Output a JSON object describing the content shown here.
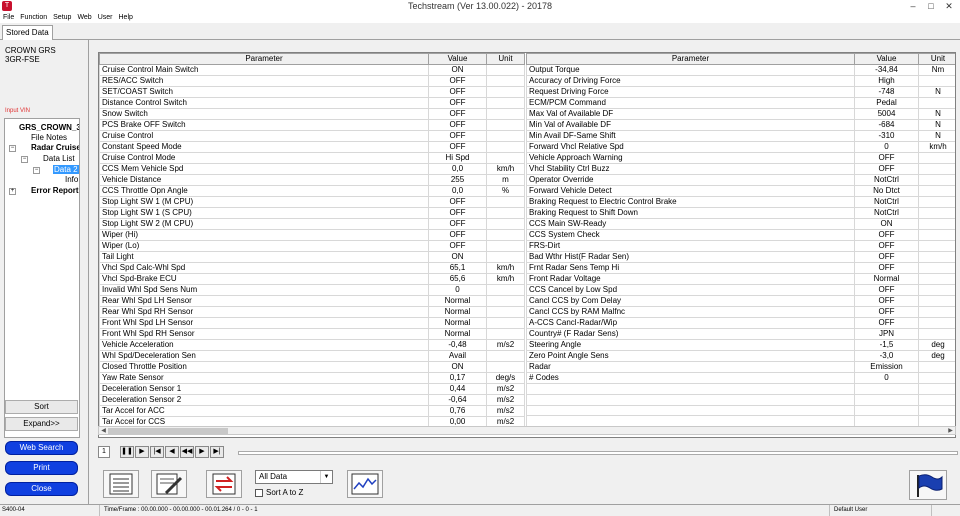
{
  "window": {
    "title": "Techstream (Ver 13.00.022) - 20178",
    "minimize": "–",
    "maximize": "□",
    "close": "✕"
  },
  "menu": [
    "File",
    "Function",
    "Setup",
    "Web",
    "User",
    "Help"
  ],
  "tab": "Stored Data",
  "vehicle": {
    "line1": "CROWN GRS",
    "line2": "3GR-FSE"
  },
  "input_vin": "Input VIN",
  "tree": {
    "root": "GRS_CROWN_3",
    "file_notes": "File Notes",
    "radar_cruise": "Radar Cruise",
    "data_list": "Data List",
    "data2": "Data 2",
    "info": "Info",
    "error_report": "Error Report"
  },
  "buttons": {
    "sort": "Sort",
    "expand": "Expand>>",
    "web_search": "Web Search",
    "print": "Print",
    "close": "Close"
  },
  "grid": {
    "headers": {
      "parameter": "Parameter",
      "value": "Value",
      "unit": "Unit"
    },
    "left": [
      [
        "Cruise Control Main Switch",
        "ON",
        ""
      ],
      [
        "RES/ACC Switch",
        "OFF",
        ""
      ],
      [
        "SET/COAST Switch",
        "OFF",
        ""
      ],
      [
        "Distance Control Switch",
        "OFF",
        ""
      ],
      [
        "Snow Switch",
        "OFF",
        ""
      ],
      [
        "PCS Brake OFF Switch",
        "OFF",
        ""
      ],
      [
        "Cruise Control",
        "OFF",
        ""
      ],
      [
        "Constant Speed Mode",
        "OFF",
        ""
      ],
      [
        "Cruise Control Mode",
        "Hi Spd",
        ""
      ],
      [
        "CCS Mem Vehicle Spd",
        "0,0",
        "km/h"
      ],
      [
        "Vehicle Distance",
        "255",
        "m"
      ],
      [
        "CCS Throttle Opn Angle",
        "0,0",
        "%"
      ],
      [
        "Stop Light SW 1 (M CPU)",
        "OFF",
        ""
      ],
      [
        "Stop Light SW 1 (S CPU)",
        "OFF",
        ""
      ],
      [
        "Stop Light SW 2 (M CPU)",
        "OFF",
        ""
      ],
      [
        "Wiper (Hi)",
        "OFF",
        ""
      ],
      [
        "Wiper (Lo)",
        "OFF",
        ""
      ],
      [
        "Tail Light",
        "ON",
        ""
      ],
      [
        "Vhcl Spd Calc-Whl Spd",
        "65,1",
        "km/h"
      ],
      [
        "Vhcl Spd-Brake ECU",
        "65,6",
        "km/h"
      ],
      [
        "Invalid Whl Spd Sens Num",
        "0",
        ""
      ],
      [
        "Rear Whl Spd LH Sensor",
        "Normal",
        ""
      ],
      [
        "Rear Whl Spd RH Sensor",
        "Normal",
        ""
      ],
      [
        "Front Whl Spd LH Sensor",
        "Normal",
        ""
      ],
      [
        "Front Whl Spd RH Sensor",
        "Normal",
        ""
      ],
      [
        "Vehicle Acceleration",
        "-0,48",
        "m/s2"
      ],
      [
        "Whl Spd/Deceleration Sen",
        "Avail",
        ""
      ],
      [
        "Closed Throttle Position",
        "ON",
        ""
      ],
      [
        "Yaw Rate Sensor",
        "0,17",
        "deg/s"
      ],
      [
        "Deceleration Sensor 1",
        "0,44",
        "m/s2"
      ],
      [
        "Deceleration Sensor 2",
        "-0,64",
        "m/s2"
      ],
      [
        "Tar Accel for ACC",
        "0,76",
        "m/s2"
      ],
      [
        "Tar Accel for CCS",
        "0,00",
        "m/s2"
      ]
    ],
    "right": [
      [
        "Output Torque",
        "-34,84",
        "Nm"
      ],
      [
        "Accuracy of Driving Force",
        "High",
        ""
      ],
      [
        "Request Driving Force",
        "-748",
        "N"
      ],
      [
        "ECM/PCM Command",
        "Pedal",
        ""
      ],
      [
        "Max Val of Available DF",
        "5004",
        "N"
      ],
      [
        "Min Val of Available DF",
        "-684",
        "N"
      ],
      [
        "Min Avail DF-Same Shift",
        "-310",
        "N"
      ],
      [
        "Forward Vhcl Relative Spd",
        "0",
        "km/h"
      ],
      [
        "Vehicle Approach Warning",
        "OFF",
        ""
      ],
      [
        "Vhcl Stability Ctrl Buzz",
        "OFF",
        ""
      ],
      [
        "Operator Override",
        "NotCtrl",
        ""
      ],
      [
        "Forward Vehicle Detect",
        "No Dtct",
        ""
      ],
      [
        "Braking Request to Electric Control Brake",
        "NotCtrl",
        ""
      ],
      [
        "Braking Request to Shift Down",
        "NotCtrl",
        ""
      ],
      [
        "CCS Main SW-Ready",
        "ON",
        ""
      ],
      [
        "CCS System Check",
        "OFF",
        ""
      ],
      [
        "FRS-Dirt",
        "OFF",
        ""
      ],
      [
        "Bad Wthr Hist(F Radar Sen)",
        "OFF",
        ""
      ],
      [
        "Frnt Radar Sens Temp Hi",
        "OFF",
        ""
      ],
      [
        "Front Radar Voltage",
        "Normal",
        ""
      ],
      [
        "CCS Cancel by Low Spd",
        "OFF",
        ""
      ],
      [
        "Cancl CCS by Com Delay",
        "OFF",
        ""
      ],
      [
        "Cancl CCS by RAM Malfnc",
        "OFF",
        ""
      ],
      [
        "A-CCS Cancl-Radar/Wip",
        "OFF",
        ""
      ],
      [
        "Country# (F Radar Sens)",
        "JPN",
        ""
      ],
      [
        "Steering Angle",
        "-1,5",
        "deg"
      ],
      [
        "Zero Point Angle Sens",
        "-3,0",
        "deg"
      ],
      [
        "Radar",
        "Emission",
        ""
      ],
      [
        "# Codes",
        "0",
        ""
      ],
      [
        "",
        "",
        ""
      ],
      [
        "",
        "",
        ""
      ],
      [
        "",
        "",
        ""
      ],
      [
        "",
        "",
        ""
      ]
    ]
  },
  "player": {
    "frame": "1"
  },
  "combo": {
    "value": "All Data"
  },
  "sort_label": "Sort A to Z",
  "status": {
    "code": "S400-04",
    "time": "Time/Frame : 00.00.000 - 00.00.000 - 00.01.264 / 0 - 0 - 1",
    "user": "Default User"
  }
}
